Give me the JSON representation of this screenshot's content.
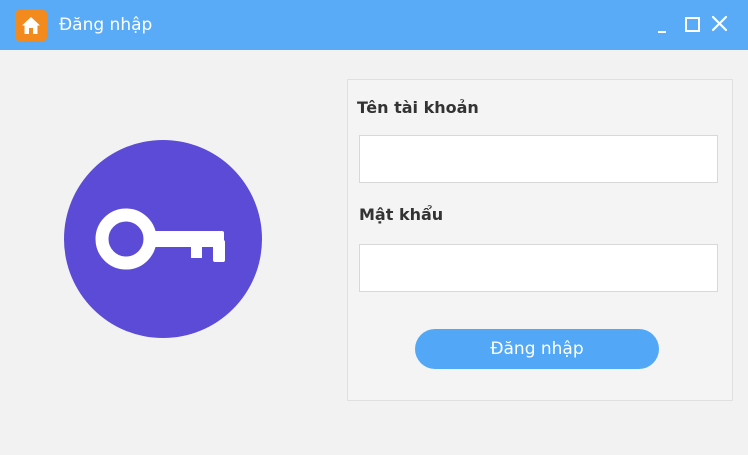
{
  "window": {
    "title": "Đăng nhập",
    "app_icon": "home-icon",
    "controls": [
      "minimize-icon",
      "maximize-icon",
      "close-icon"
    ]
  },
  "illustration": {
    "icon": "key-icon",
    "color": "#5b4bd6"
  },
  "form": {
    "username_label": "Tên tài khoản",
    "username_value": "",
    "password_label": "Mật khẩu",
    "password_value": "",
    "submit_label": "Đăng nhập"
  },
  "colors": {
    "titlebar": "#5aabf7",
    "app_icon_bg": "#f28a1e",
    "button": "#52a8f6"
  }
}
